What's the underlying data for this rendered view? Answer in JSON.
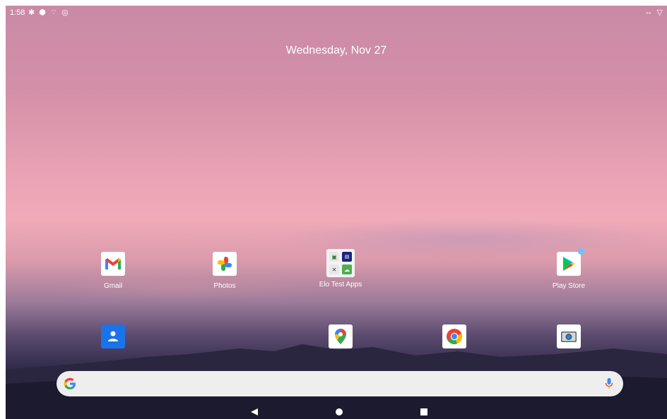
{
  "status_bar": {
    "time": "1:58",
    "left_icons": [
      "settings-icon",
      "shield-icon",
      "wifi-off-icon",
      "sync-icon"
    ],
    "right_icons": [
      "data-transfer-icon",
      "wifi-icon"
    ]
  },
  "date": "Wednesday, Nov 27",
  "home_apps": [
    {
      "label": "Gmail",
      "icon": "gmail-icon"
    },
    {
      "label": "Photos",
      "icon": "photos-icon"
    },
    {
      "label": "Elo Test Apps",
      "icon": "folder-icon"
    },
    {
      "label": "Play Store",
      "icon": "play-store-icon"
    }
  ],
  "dock_apps": [
    {
      "icon": "contacts-icon"
    },
    {
      "icon": "maps-icon"
    },
    {
      "icon": "chrome-icon"
    },
    {
      "icon": "camera-icon"
    }
  ],
  "search_bar": {
    "logo": "google-g-icon",
    "mic": "mic-icon"
  },
  "navigation": [
    "back-icon",
    "home-icon",
    "recents-icon"
  ],
  "colors": {
    "dock_contacts_bg": "#1a73e8",
    "badge": "#6ec1ff"
  }
}
